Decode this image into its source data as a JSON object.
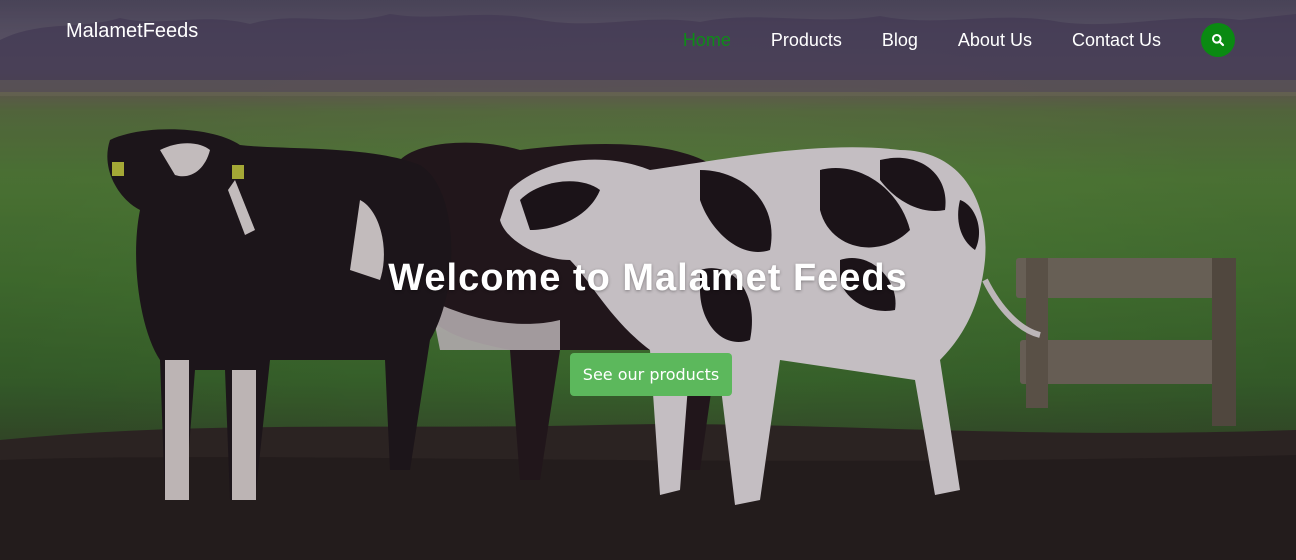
{
  "brand": {
    "name": "MalametFeeds"
  },
  "nav": {
    "items": [
      {
        "label": "Home",
        "active": true
      },
      {
        "label": "Products",
        "active": false
      },
      {
        "label": "Blog",
        "active": false
      },
      {
        "label": "About Us",
        "active": false
      },
      {
        "label": "Contact Us",
        "active": false
      }
    ],
    "search_icon": "search-icon"
  },
  "hero": {
    "headline": "Welcome to Malamet Feeds",
    "cta_label": "See our products",
    "background": "cows grazing in a green pasture at sunset"
  },
  "colors": {
    "active_nav": "#0f8a19",
    "search_button": "#0a8a12",
    "cta": "#5cb85c",
    "text": "#ffffff"
  }
}
